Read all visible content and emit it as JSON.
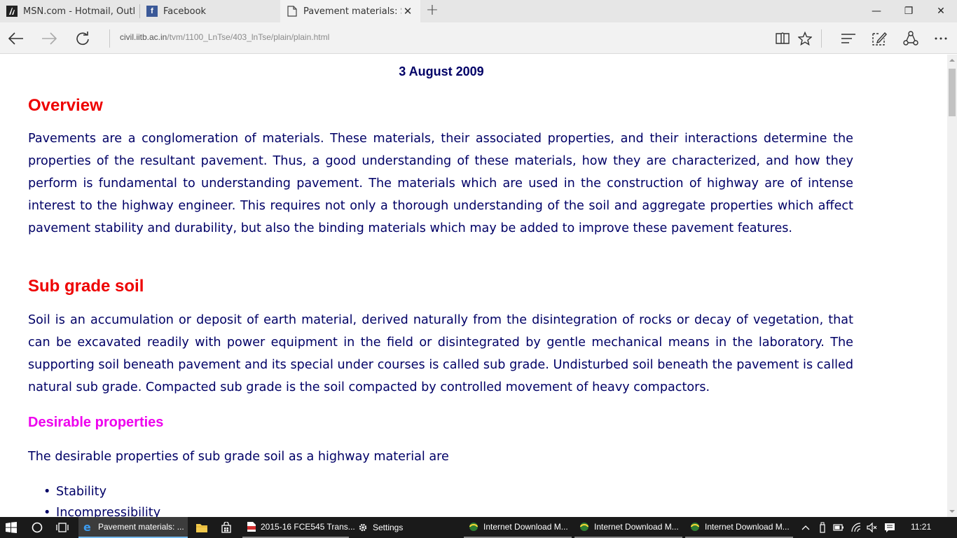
{
  "browser": {
    "tabs": [
      {
        "title": "MSN.com - Hotmail, Outloc",
        "icon": "msn-icon"
      },
      {
        "title": "Facebook",
        "icon": "facebook-icon"
      },
      {
        "title": "Pavement materials: Soi",
        "icon": "page-icon",
        "active": true
      }
    ],
    "new_tab": "+",
    "window_controls": {
      "minimize": "—",
      "restore": "❐",
      "close": "✕"
    },
    "url": {
      "host": "civil.iitb.ac.in",
      "path": "/tvm/1100_LnTse/403_lnTse/plain/plain.html"
    }
  },
  "page": {
    "date": "3 August 2009",
    "overview_heading": "Overview",
    "overview_text": "Pavements are a conglomeration of materials. These materials, their associated properties, and their interactions determine the properties of the resultant pavement. Thus, a good understanding of these materials, how they are characterized, and how they perform is fundamental to understanding pavement. The materials which are used in the construction of highway are of intense interest to the highway engineer. This requires not only a thorough understanding of the soil and aggregate properties which affect pavement stability and durability, but also the binding materials which may be added to improve these pavement features.",
    "subgrade_heading": "Sub grade soil",
    "subgrade_text": "Soil is an accumulation or deposit of earth material, derived naturally from the disintegration of rocks or decay of vegetation, that can be excavated readily with power equipment in the field or disintegrated by gentle mechanical means in the laboratory. The supporting soil beneath pavement and its special under courses is called sub grade. Undisturbed soil beneath the pavement is called natural sub grade. Compacted sub grade is the soil compacted by controlled movement of heavy compactors.",
    "desirable_heading": "Desirable properties",
    "desirable_intro": "The desirable properties of sub grade soil as a highway material are",
    "desirable_list": [
      "Stability",
      "Incompressibility"
    ]
  },
  "taskbar": {
    "tasks": [
      {
        "label": "Pavement materials: ..."
      },
      {
        "label": "2015-16 FCE545 Trans..."
      },
      {
        "label": "Settings"
      },
      {
        "label": "Internet Download M..."
      },
      {
        "label": "Internet Download M..."
      },
      {
        "label": "Internet Download M..."
      }
    ],
    "clock": "11:21"
  },
  "colors": {
    "heading": "#ee0000",
    "subheading": "#ee00ee",
    "body_text": "#000066",
    "edge_blue": "#1e78d2"
  }
}
